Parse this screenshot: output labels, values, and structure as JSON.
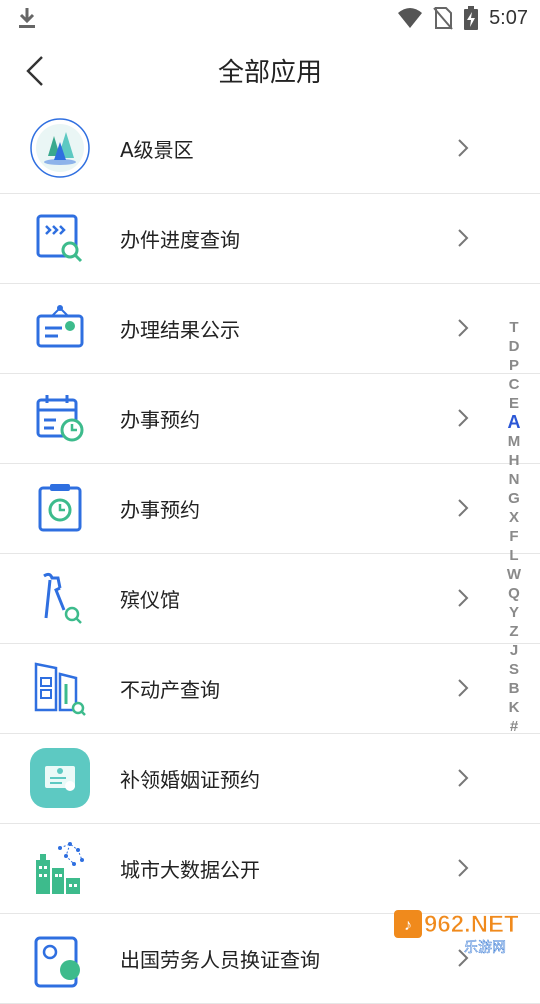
{
  "status": {
    "time": "5:07"
  },
  "header": {
    "title": "全部应用"
  },
  "items": [
    {
      "label": "A级景区"
    },
    {
      "label": "办件进度查询"
    },
    {
      "label": "办理结果公示"
    },
    {
      "label": "办事预约"
    },
    {
      "label": "办事预约"
    },
    {
      "label": "殡仪馆"
    },
    {
      "label": "不动产查询"
    },
    {
      "label": "补领婚姻证预约"
    },
    {
      "label": "城市大数据公开"
    },
    {
      "label": "出国劳务人员换证查询"
    }
  ],
  "index_letters": [
    "T",
    "D",
    "P",
    "C",
    "E",
    "A",
    "M",
    "H",
    "N",
    "G",
    "X",
    "F",
    "L",
    "W",
    "Q",
    "Y",
    "Z",
    "J",
    "S",
    "B",
    "K",
    "#"
  ],
  "index_active": "A",
  "watermark": {
    "main": "962.NET",
    "sub": "乐游网"
  },
  "colors": {
    "accent": "#2b57d6",
    "icon_blue": "#2f6fe0",
    "icon_teal": "#5dc9c2",
    "icon_green": "#3dbb8c"
  }
}
